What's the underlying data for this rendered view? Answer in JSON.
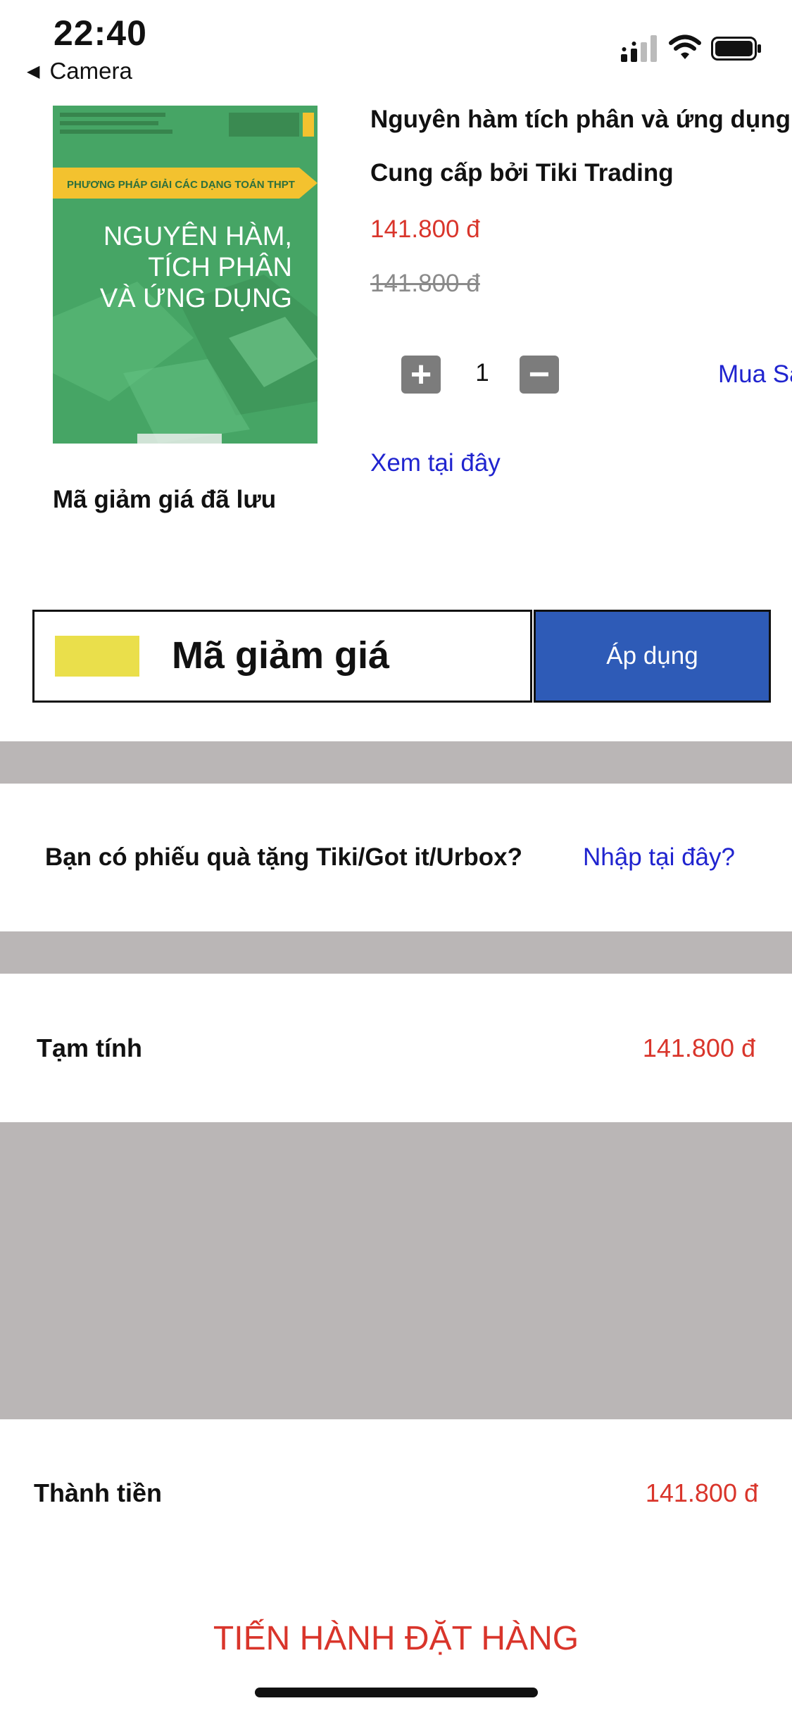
{
  "status_bar": {
    "time": "22:40",
    "back_label": "Camera",
    "back_icon": "back-triangle-icon",
    "signal_icon": "cellular-signal-icon",
    "wifi_icon": "wifi-icon",
    "battery_icon": "battery-icon"
  },
  "product": {
    "cover_alt": "book-cover",
    "cover": {
      "top_text": "PHƯƠNG PHÁP GIẢI CÁC DẠNG TOÁN THPT",
      "title_lines": [
        "NGUYÊN HÀM,",
        "TÍCH PHÂN",
        "VÀ ỨNG DỤNG"
      ],
      "colors": {
        "background": "#46a565",
        "banner": "#f3c22f",
        "text": "#ffffff"
      }
    },
    "title": "Nguyên hàm tích phân và ứng dụng",
    "seller": "Cung cấp bởi Tiki Trading",
    "price": "141.800 đ",
    "original_price": "141.800 đ",
    "quantity": "1",
    "plus_icon": "plus-icon",
    "minus_icon": "minus-icon",
    "buy_later": "Mua Sau",
    "view_here": "Xem tại đây"
  },
  "coupon": {
    "saved_label": "Mã giảm giá đã lưu",
    "input_label": "Mã giảm giá",
    "apply_button": "Áp dụng"
  },
  "gift": {
    "question": "Bạn có phiếu quà tặng Tiki/Got it/Urbox?",
    "link": "Nhập tại đây?"
  },
  "summary": {
    "subtotal_label": "Tạm tính",
    "subtotal_value": "141.800 đ",
    "total_label": "Thành tiền",
    "total_value": "141.800 đ"
  },
  "checkout_button": "TIẾN HÀNH ĐẶT HÀNG",
  "colors": {
    "price_red": "#d9352b",
    "link_blue": "#2024cf",
    "apply_blue": "#2e5bb7",
    "separator_gray": "#bab6b6",
    "coupon_yellow": "#eadf4b"
  }
}
